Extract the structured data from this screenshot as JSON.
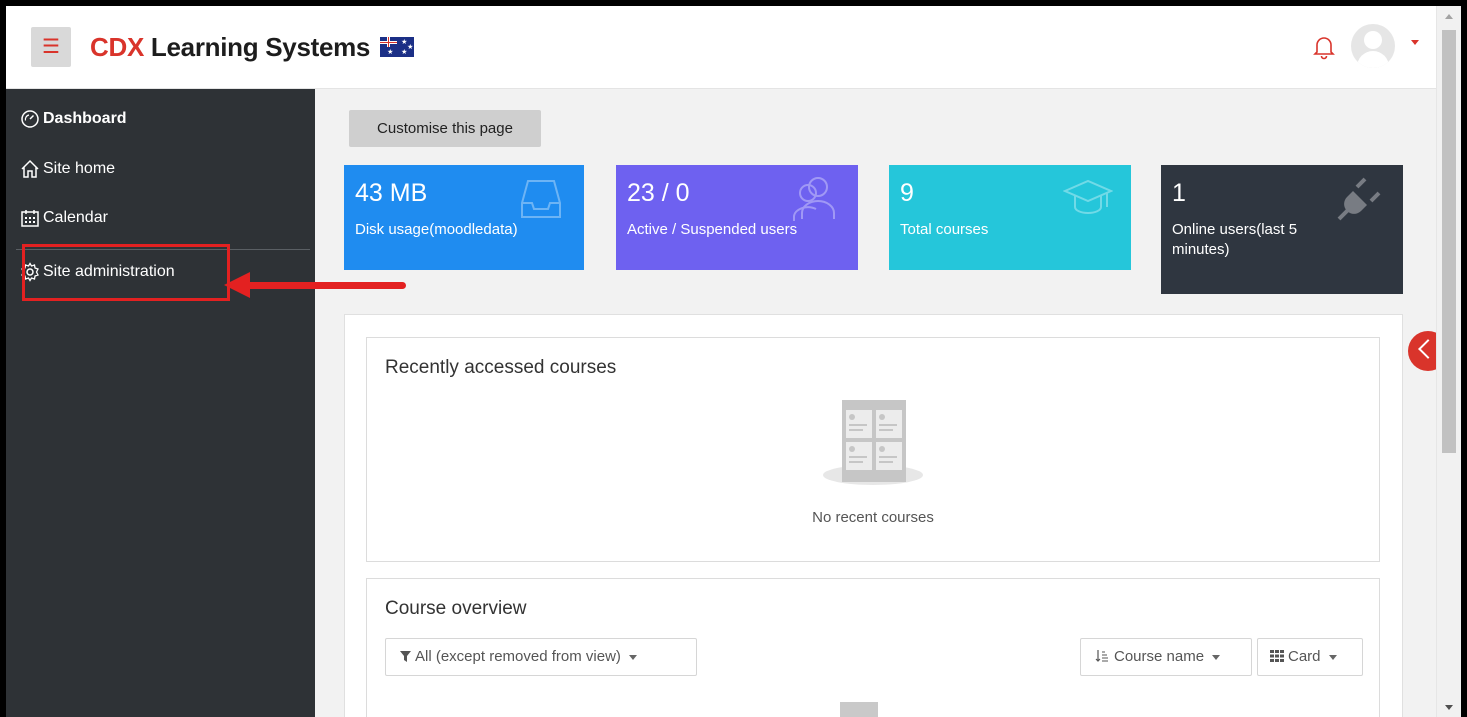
{
  "header": {
    "menu_icon": "hamburger-icon",
    "brand_prefix": "CDX",
    "brand_suffix": " Learning Systems",
    "flag": "australia-flag",
    "bell_icon": "bell-icon",
    "avatar_icon": "user-avatar",
    "accent_color": "#d9342b"
  },
  "sidebar": {
    "items": [
      {
        "label": "Dashboard",
        "icon": "dashboard-gauge-icon"
      },
      {
        "label": "Site home",
        "icon": "home-icon"
      },
      {
        "label": "Calendar",
        "icon": "calendar-icon"
      },
      {
        "label": "Site administration",
        "icon": "gear-icon"
      }
    ]
  },
  "main": {
    "customise_label": "Customise this page",
    "stats": [
      {
        "value": "43 MB",
        "label": "Disk usage(moodledata)",
        "icon": "inbox-tray-icon",
        "color": "#1f8cf0"
      },
      {
        "value": "23 / 0",
        "label": "Active / Suspended users",
        "icon": "users-icon",
        "color": "#6e61f0"
      },
      {
        "value": "9",
        "label": "Total courses",
        "icon": "graduation-cap-icon",
        "color": "#25c6da"
      },
      {
        "value": "1",
        "label": "Online users(last 5 minutes)",
        "icon": "plug-icon",
        "color": "#2f3640"
      }
    ],
    "recent": {
      "title": "Recently accessed courses",
      "empty_text": "No recent courses"
    },
    "overview": {
      "title": "Course overview",
      "filter_label": "All (except removed from view)",
      "sort_label": "Course name",
      "view_label": "Card"
    }
  }
}
